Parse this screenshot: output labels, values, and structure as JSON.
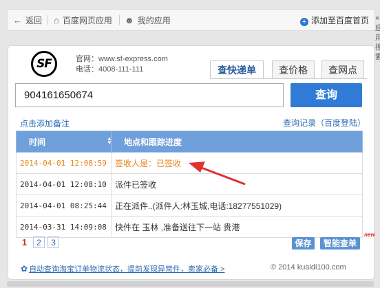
{
  "topbar": {
    "back_label": "返回",
    "baidu_app_label": "百度网页应用",
    "my_apps_label": "我的应用",
    "add_home_label": "添加至百度首页"
  },
  "side_text": [
    "×",
    "应",
    "用",
    "搜",
    "索"
  ],
  "courier": {
    "logo_text": "SF",
    "website": "官网：www.sf-express.com",
    "phone": "电话：4008-111-111"
  },
  "tabs": [
    "查快递单",
    "查价格",
    "查网点"
  ],
  "search": {
    "value": "904161650674",
    "button_label": "查询"
  },
  "add_note_label": "点击添加备注",
  "history_label": "查询记录（百度登陆）",
  "table": {
    "headers": [
      "时间",
      "地点和跟踪进度"
    ],
    "rows": [
      {
        "time": "2014-04-01 12:08:59",
        "status": "签收人是：已签收"
      },
      {
        "time": "2014-04-01 12:08:10",
        "status": "派件已签收"
      },
      {
        "time": "2014-04-01 08:25:44",
        "status": "正在派件..(派件人:林玉城,电话:18277551029)"
      },
      {
        "time": "2014-03-31 14:09:08",
        "status": "快件在 玉林 ,准备送往下一站 贵港"
      }
    ]
  },
  "pagination": [
    "1",
    "2",
    "3"
  ],
  "buttons": {
    "save_label": "保存",
    "smart_label": "智能查单",
    "new_badge": "new"
  },
  "footer": {
    "link_text": "自动查询淘宝订单物流状态，提前发现异常件，卖家必备 >",
    "copyright": "© 2014 kuaidi100.com"
  },
  "colors": {
    "accent": "#2f7bd5",
    "latest_row": "#e8851a",
    "arrow": "#e03030"
  }
}
